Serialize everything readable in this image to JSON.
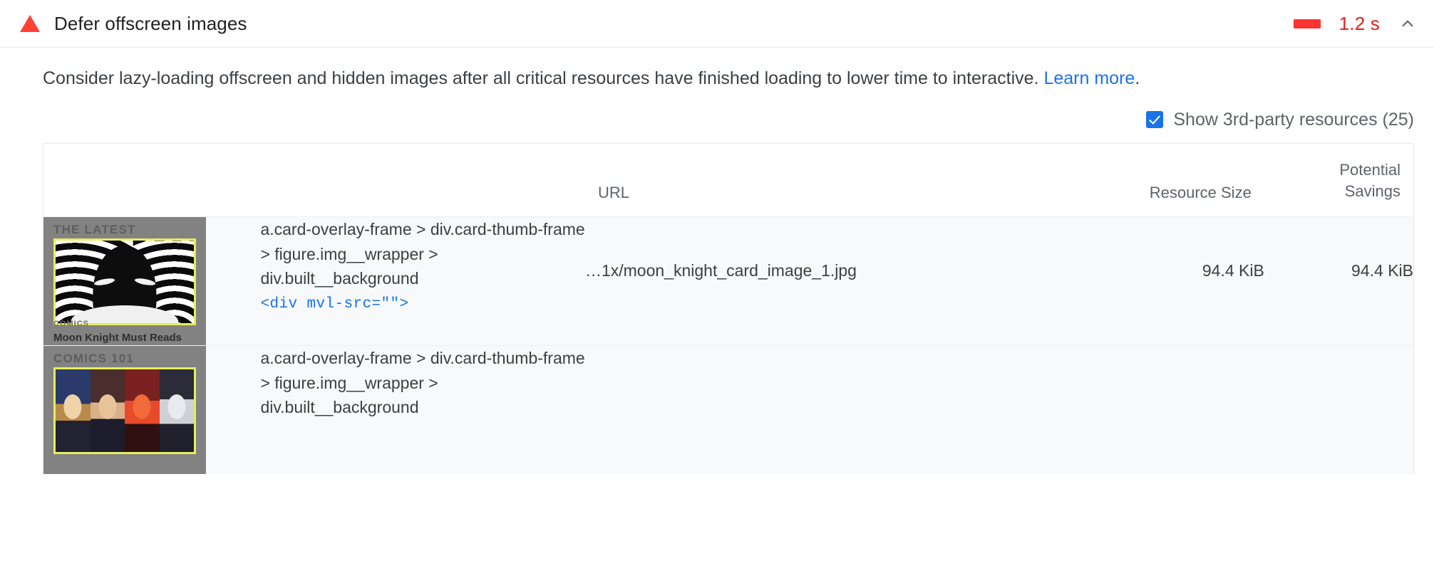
{
  "audit": {
    "icon": "warning-triangle-icon",
    "title": "Defer offscreen images",
    "score_bar_color": "#ff3333",
    "metric_value": "1.2 s",
    "metric_color": "#e02020",
    "expand_icon": "chevron-up-icon",
    "description_prefix": "Consider lazy-loading offscreen and hidden images after all critical resources have finished loading to lower time to interactive. ",
    "learn_more_label": "Learn more",
    "description_suffix": "."
  },
  "filter": {
    "checkbox_icon": "checkbox-checked-icon",
    "checked": true,
    "label": "Show 3rd-party resources (25)",
    "accent_color": "#1a73e8"
  },
  "table": {
    "headers": {
      "thumbnail": "",
      "node": "",
      "url": "URL",
      "resource_size": "Resource Size",
      "potential_savings_line1": "Potential",
      "potential_savings_line2": "Savings"
    },
    "rows": [
      {
        "thumbnail": {
          "kicker": "THE LATEST",
          "caption_sub": "COMICS",
          "caption_title": "Moon Knight Must Reads",
          "art": "moon-knight-thumbnail"
        },
        "node_path": "a.card-overlay-frame > div.card-thumb-frame > figure.img__wrapper > div.built__background",
        "node_snippet": "<div mvl-src=\"\">",
        "url": "…1x/moon_knight_card_image_1.jpg",
        "resource_size": "94.4 KiB",
        "potential_savings": "94.4 KiB"
      },
      {
        "thumbnail": {
          "kicker": "COMICS 101",
          "caption_sub": "",
          "caption_title": "",
          "art": "group-characters-thumbnail"
        },
        "node_path": "a.card-overlay-frame > div.card-thumb-frame > figure.img__wrapper > div.built__background",
        "node_snippet": "",
        "url": "",
        "resource_size": "",
        "potential_savings": ""
      }
    ]
  }
}
